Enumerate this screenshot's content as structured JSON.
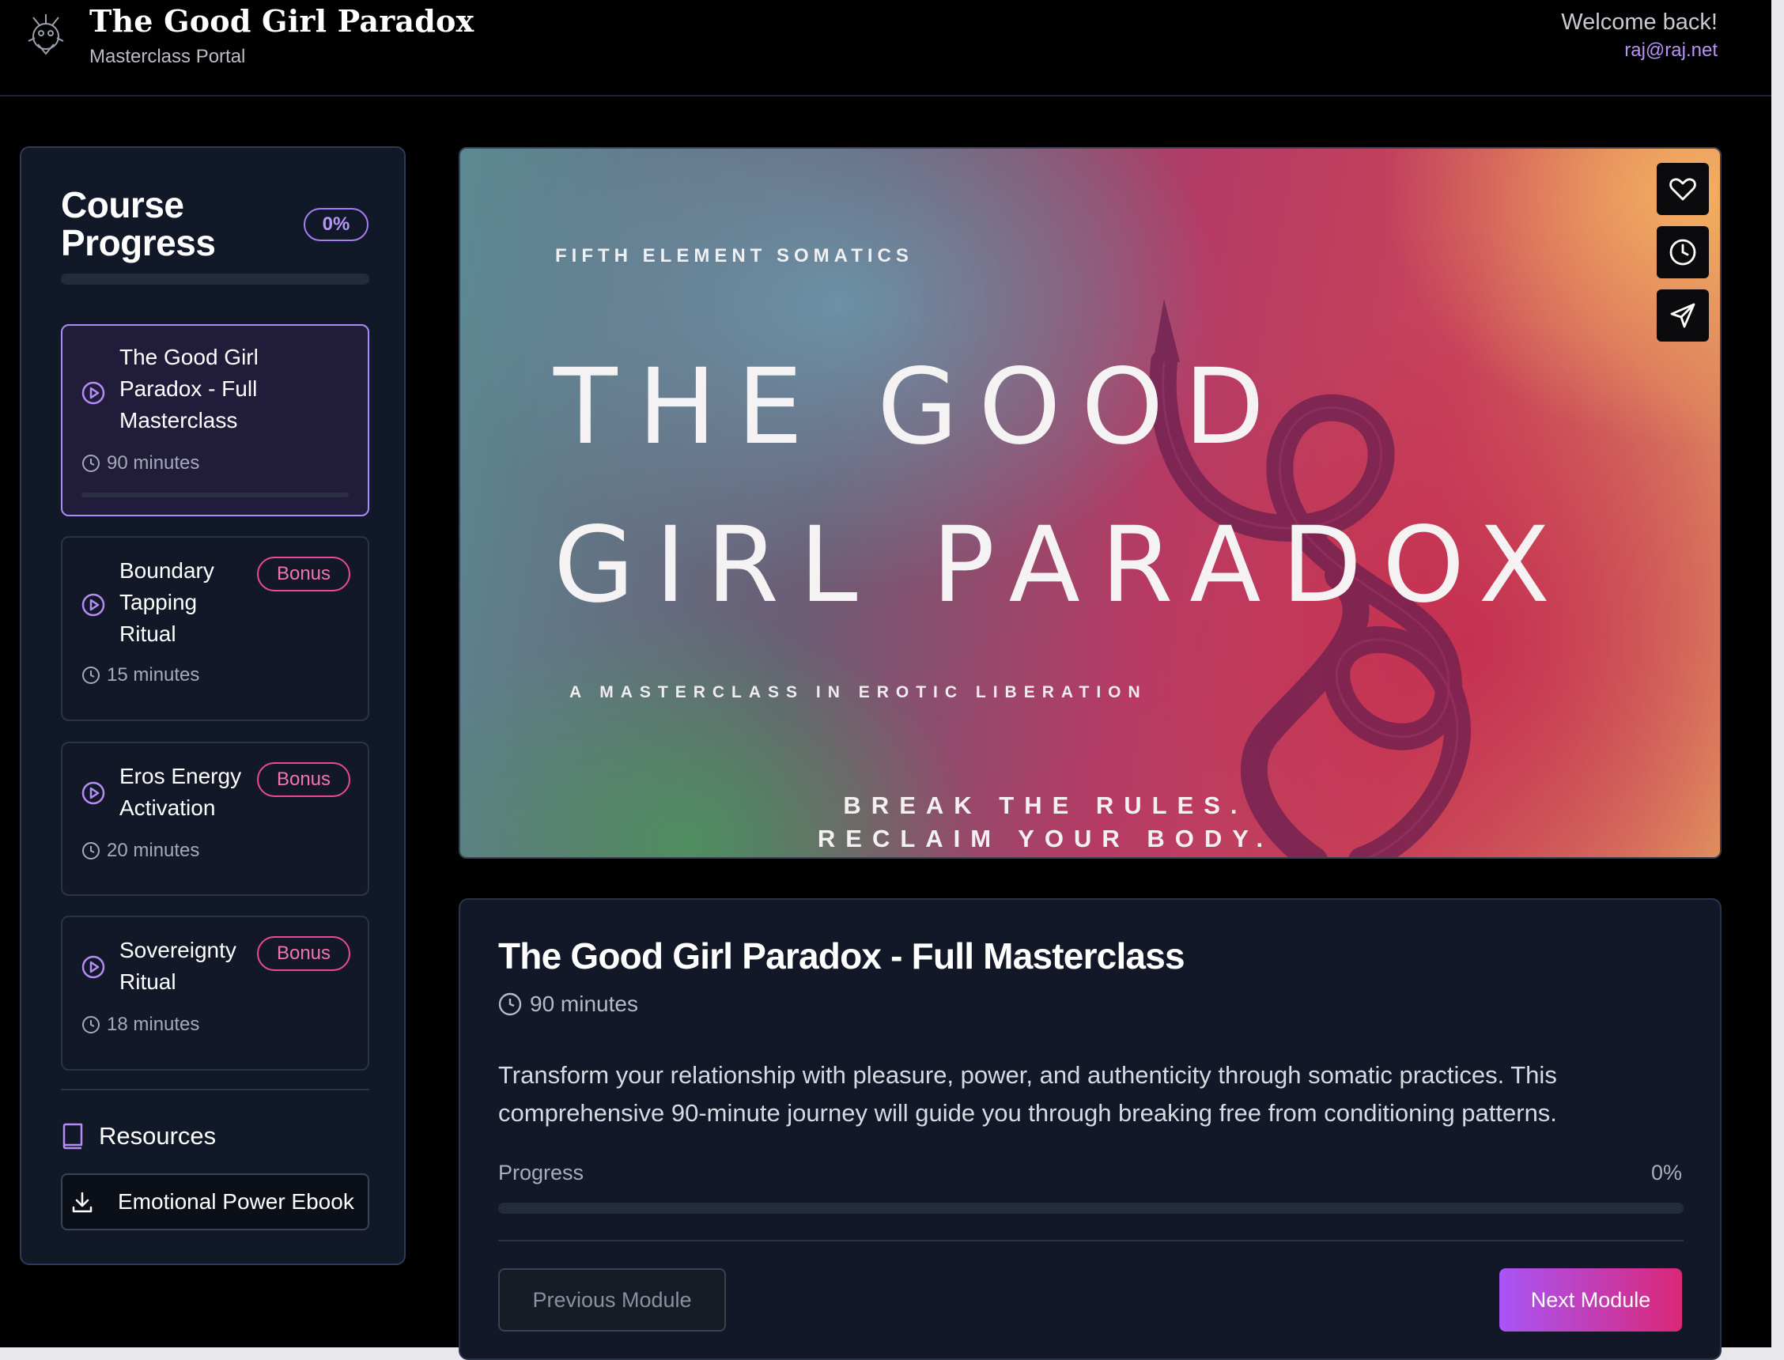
{
  "header": {
    "title": "The Good Girl Paradox",
    "subtitle": "Masterclass Portal",
    "welcome": "Welcome back!",
    "email": "raj@raj.net"
  },
  "sidebar": {
    "title": "Course Progress",
    "progress_label": "0%",
    "progress_fraction": 0,
    "modules": [
      {
        "title": "The Good Girl Paradox - Full Masterclass",
        "duration": "90 minutes",
        "bonus": "",
        "active": true
      },
      {
        "title": "Boundary Tapping Ritual",
        "duration": "15 minutes",
        "bonus": "Bonus",
        "active": false
      },
      {
        "title": "Eros Energy Activation",
        "duration": "20 minutes",
        "bonus": "Bonus",
        "active": false
      },
      {
        "title": "Sovereignty Ritual",
        "duration": "18 minutes",
        "bonus": "Bonus",
        "active": false
      }
    ],
    "resources_title": "Resources",
    "resources": [
      {
        "label": "Emotional Power Ebook",
        "icon": "download-icon"
      }
    ]
  },
  "hero": {
    "brand": "FIFTH ELEMENT SOMATICS",
    "title_line1": "THE GOOD",
    "title_line2": "GIRL PARADOX",
    "subtitle": "A MASTERCLASS IN EROTIC LIBERATION",
    "tag_line1": "BREAK THE RULES.",
    "tag_line2": "RECLAIM YOUR BODY.",
    "actions": [
      "heart-icon",
      "clock-icon",
      "send-icon"
    ]
  },
  "lesson": {
    "title": "The Good Girl Paradox - Full Masterclass",
    "duration": "90 minutes",
    "description": "Transform your relationship with pleasure, power, and authenticity through somatic practices. This comprehensive 90-minute journey will guide you through breaking free from conditioning patterns.",
    "progress_label": "Progress",
    "progress_value": "0%",
    "progress_fraction": 0,
    "prev_label": "Previous Module",
    "next_label": "Next Module"
  },
  "colors": {
    "accent": "#a855f7",
    "bonus": "#ec4899",
    "panel": "#111827"
  }
}
